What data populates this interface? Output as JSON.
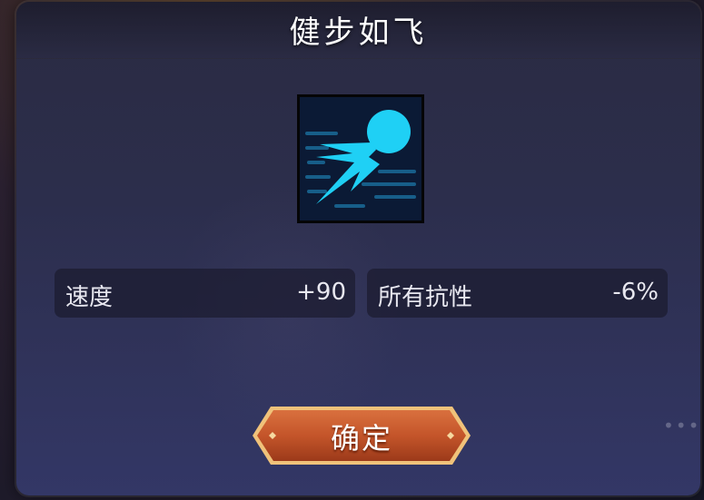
{
  "dialog": {
    "title": "健步如飞",
    "icon": "speed-dash-icon",
    "stats": [
      {
        "label": "速度",
        "value": "+90"
      },
      {
        "label": "所有抗性",
        "value": "-6%"
      }
    ],
    "confirm_label": "确定"
  },
  "colors": {
    "icon_cyan": "#1fd0f5",
    "button_orange": "#c4552a"
  }
}
